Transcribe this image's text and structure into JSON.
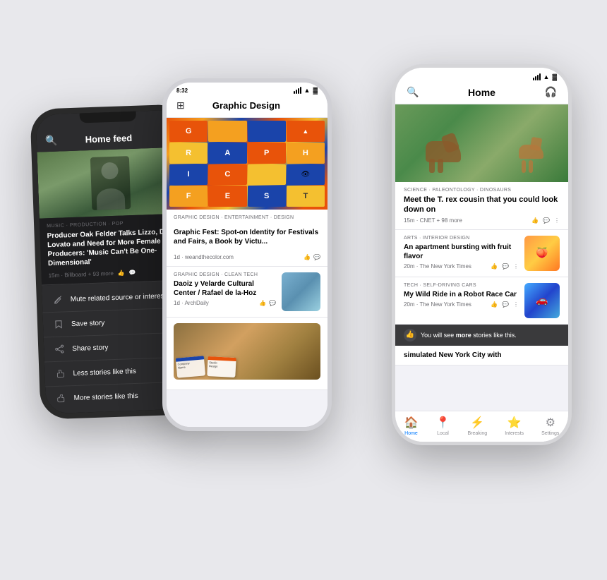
{
  "page": {
    "bg_color": "#e8e8ec"
  },
  "phone_left": {
    "header": {
      "title": "Home feed"
    },
    "article": {
      "meta": "MUSIC · PRODUCTION · POP",
      "title": "Producer Oak Felder Talks Lizzo, Demi Lovato and Need for More Female Producers: 'Music Can't Be One-Dimensional'",
      "source": "15m · Billboard + 93 more"
    },
    "menu": [
      {
        "icon": "pencil-icon",
        "label": "Mute related source or interest"
      },
      {
        "icon": "bookmark-icon",
        "label": "Save story"
      },
      {
        "icon": "share-icon",
        "label": "Share story"
      },
      {
        "icon": "dislike-icon",
        "label": "Less stories like this"
      },
      {
        "icon": "like-icon",
        "label": "More stories like this"
      }
    ]
  },
  "phone_middle": {
    "status": {
      "time": "8:32",
      "signal": "●●●",
      "wifi": "▲",
      "battery": "■"
    },
    "header": {
      "title": "Graphic Design"
    },
    "hero_text": "GRAPH\nIC FE\nST.",
    "articles": [
      {
        "meta": "GRAPHIC DESIGN · ENTERTAINMENT · DESIGN",
        "title": "Graphic Fest: Spot-on Identity for Festivals and Fairs, a Book by Victu...",
        "source": "1d · weandthecolor.com",
        "has_like": true
      },
      {
        "meta": "GRAPHIC DESIGN · CLEAN TECH",
        "title": "Daoiz y Velarde Cultural Center / Rafael de la-Hoz",
        "source": "1d · ArchDaily",
        "has_like": false
      }
    ]
  },
  "phone_right": {
    "status": {
      "time": "",
      "battery": ""
    },
    "header": {
      "title": "Home"
    },
    "hero_article": {
      "meta": "SCIENCE · PALEONTOLOGY · DINOSAURS",
      "title": "Meet the T. rex cousin that you could look down on",
      "source": "15m · CNET + 98 more"
    },
    "articles": [
      {
        "meta": "ARTS · INTERIOR DESIGN",
        "title": "An apartment bursting with fruit flavor",
        "source": "20m · The New York Times",
        "thumb_color": "#ff9944",
        "liked": true
      },
      {
        "meta": "TECH · SELF-DRIVING CARS",
        "title": "My Wild Ride in a Robot Race Car",
        "source": "20m · The New York Times",
        "thumb_color": "#44aaff",
        "liked": false
      }
    ],
    "notification": "You will see more stories like this.",
    "partial_title": "simulated New York City with",
    "tabs": [
      {
        "label": "Home",
        "icon": "🏠",
        "active": true
      },
      {
        "label": "Local",
        "icon": "📍",
        "active": false
      },
      {
        "label": "Breaking",
        "icon": "⚡",
        "active": false
      },
      {
        "label": "Interests",
        "icon": "⭐",
        "active": false
      },
      {
        "label": "Settings",
        "icon": "⚙",
        "active": false
      }
    ]
  }
}
